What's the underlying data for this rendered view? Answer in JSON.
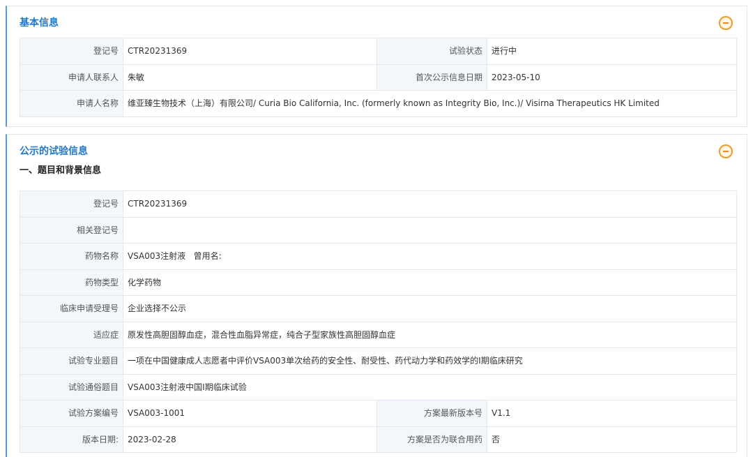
{
  "basic": {
    "title": "基本信息",
    "rows": {
      "reg_no": {
        "label": "登记号",
        "value": "CTR20231369"
      },
      "status": {
        "label": "试验状态",
        "value": "进行中"
      },
      "contact": {
        "label": "申请人联系人",
        "value": "朱敏"
      },
      "first_pub": {
        "label": "首次公示信息日期",
        "value": "2023-05-10"
      },
      "applicant": {
        "label": "申请人名称",
        "value": "维亚臻生物技术（上海）有限公司/ Curia Bio California, Inc. (formerly known as Integrity Bio, Inc.)/ Visirna Therapeutics HK Limited"
      }
    }
  },
  "trial": {
    "title": "公示的试验信息",
    "section_title": "一、题目和背景信息",
    "rows": {
      "reg_no": {
        "label": "登记号",
        "value": "CTR20231369"
      },
      "related_reg": {
        "label": "相关登记号",
        "value": ""
      },
      "drug_name": {
        "label": "药物名称",
        "value": "VSA003注射液   曾用名:"
      },
      "drug_type": {
        "label": "药物类型",
        "value": "化学药物"
      },
      "clinical_no": {
        "label": "临床申请受理号",
        "value": "企业选择不公示"
      },
      "indication": {
        "label": "适应症",
        "value": "原发性高胆固醇血症，混合性血脂异常症，纯合子型家族性高胆固醇血症"
      },
      "pro_title": {
        "label": "试验专业题目",
        "value": "一项在中国健康成人志愿者中评价VSA003单次给药的安全性、耐受性、药代动力学和药效学的I期临床研究"
      },
      "popular_title": {
        "label": "试验通俗题目",
        "value": "VSA003注射液中国I期临床试验"
      },
      "protocol_no": {
        "label": "试验方案编号",
        "value": "VSA003-1001"
      },
      "latest_version": {
        "label": "方案最新版本号",
        "value": "V1.1"
      },
      "version_date": {
        "label": "版本日期:",
        "value": "2023-02-28"
      },
      "combo": {
        "label": "方案是否为联合用药",
        "value": "否"
      }
    }
  },
  "icons": {
    "collapse": "minus-circle-icon"
  },
  "colors": {
    "accent": "#1f78c8",
    "collapse_icon": "#f19a2a",
    "label_bg": "#f3f6fa",
    "border": "#e4e8ee"
  }
}
